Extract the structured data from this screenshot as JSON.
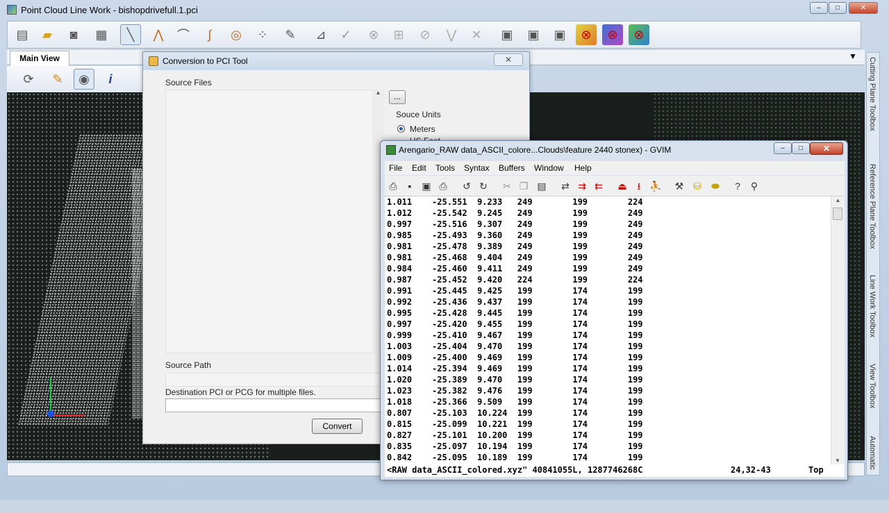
{
  "app": {
    "title": "Point Cloud Line Work - bishopdrivefull.1.pci",
    "tab": "Main View",
    "controls": {
      "minimize": "–",
      "maximize": "□",
      "close": "✕"
    },
    "sidebar": [
      "Cutting Plane Toolbox",
      "Reference Plane Toolbox",
      "Line Work Toolbox",
      "View Toolbox",
      "Automatic"
    ]
  },
  "conversion_dialog": {
    "title": "Conversion to PCI Tool",
    "close": "✕",
    "source_files_label": "Source Files",
    "browse_label": "...",
    "units_label": "Souce Units",
    "unit_meters": "Meters",
    "unit_usfeet_partial": "US Feet",
    "source_path_label": "Source Path",
    "destination_label": "Destination PCI or PCG for multiple files.",
    "convert_label": "Convert"
  },
  "gvim": {
    "title": "Arengario_RAW data_ASCII_colore...Clouds\\feature 2440 stonex) - GVIM",
    "close": "✕",
    "menu": [
      "File",
      "Edit",
      "Tools",
      "Syntax",
      "Buffers",
      "Window",
      "Help"
    ],
    "lines": [
      [
        "1.011",
        "-25.551",
        "9.233",
        "249",
        "199",
        "224"
      ],
      [
        "1.012",
        "-25.542",
        "9.245",
        "249",
        "199",
        "249"
      ],
      [
        "0.997",
        "-25.516",
        "9.307",
        "249",
        "199",
        "249"
      ],
      [
        "0.985",
        "-25.493",
        "9.360",
        "249",
        "199",
        "249"
      ],
      [
        "0.981",
        "-25.478",
        "9.389",
        "249",
        "199",
        "249"
      ],
      [
        "0.981",
        "-25.468",
        "9.404",
        "249",
        "199",
        "249"
      ],
      [
        "0.984",
        "-25.460",
        "9.411",
        "249",
        "199",
        "249"
      ],
      [
        "0.987",
        "-25.452",
        "9.420",
        "224",
        "199",
        "224"
      ],
      [
        "0.991",
        "-25.445",
        "9.425",
        "199",
        "174",
        "199"
      ],
      [
        "0.992",
        "-25.436",
        "9.437",
        "199",
        "174",
        "199"
      ],
      [
        "0.995",
        "-25.428",
        "9.445",
        "199",
        "174",
        "199"
      ],
      [
        "0.997",
        "-25.420",
        "9.455",
        "199",
        "174",
        "199"
      ],
      [
        "0.999",
        "-25.410",
        "9.467",
        "199",
        "174",
        "199"
      ],
      [
        "1.003",
        "-25.404",
        "9.470",
        "199",
        "174",
        "199"
      ],
      [
        "1.009",
        "-25.400",
        "9.469",
        "199",
        "174",
        "199"
      ],
      [
        "1.014",
        "-25.394",
        "9.469",
        "199",
        "174",
        "199"
      ],
      [
        "1.020",
        "-25.389",
        "9.470",
        "199",
        "174",
        "199"
      ],
      [
        "1.023",
        "-25.382",
        "9.476",
        "199",
        "174",
        "199"
      ],
      [
        "1.018",
        "-25.366",
        "9.509",
        "199",
        "174",
        "199"
      ],
      [
        "0.807",
        "-25.103",
        "10.224",
        "199",
        "174",
        "199"
      ],
      [
        "0.815",
        "-25.099",
        "10.221",
        "199",
        "174",
        "199"
      ],
      [
        "0.827",
        "-25.101",
        "10.200",
        "199",
        "174",
        "199"
      ],
      [
        "0.835",
        "-25.097",
        "10.194",
        "199",
        "174",
        "199"
      ],
      [
        "0.842",
        "-25.095",
        "10.189",
        "199",
        "174",
        "199"
      ]
    ],
    "status": {
      "file": "<RAW data_ASCII_colored.xyz\" 40841055L, 1287746268C",
      "position": "24,32-43",
      "scroll": "Top"
    }
  }
}
